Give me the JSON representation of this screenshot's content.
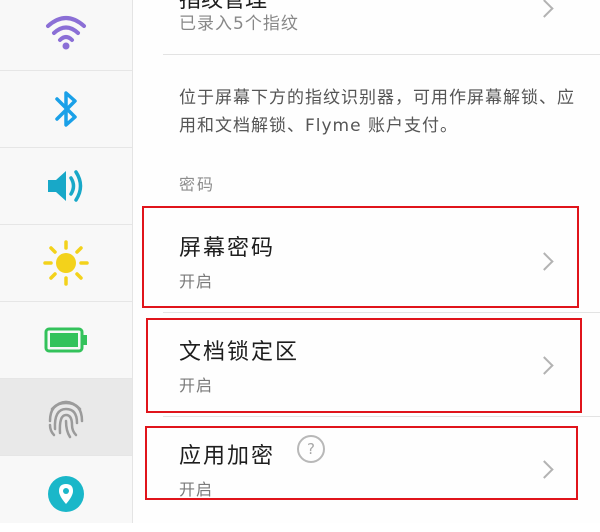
{
  "sidebar": {
    "items": [
      {
        "icon": "wifi-icon",
        "color": "#8b6fd6"
      },
      {
        "icon": "bluetooth-icon",
        "color": "#1aa0e8"
      },
      {
        "icon": "volume-icon",
        "color": "#18a8c8"
      },
      {
        "icon": "brightness-icon",
        "color": "#f3d21b"
      },
      {
        "icon": "battery-icon",
        "color": "#33c25b"
      },
      {
        "icon": "fingerprint-icon",
        "color": "#9b9b9b",
        "active": true
      },
      {
        "icon": "location-icon",
        "color": "#1ab7c9"
      }
    ]
  },
  "fingerprint_manage": {
    "title": "指纹管理",
    "subtitle": "已录入5个指纹"
  },
  "description": "位于屏幕下方的指纹识别器，可用作屏幕解锁、应用和文档解锁、Flyme 账户支付。",
  "password_section": {
    "label": "密码",
    "items": [
      {
        "title": "屏幕密码",
        "status": "开启"
      },
      {
        "title": "文档锁定区",
        "status": "开启"
      },
      {
        "title": "应用加密",
        "status": "开启",
        "help": "?"
      }
    ]
  },
  "colors": {
    "highlight": "#e0141b",
    "sidebar_active": "#e9e9e9"
  }
}
